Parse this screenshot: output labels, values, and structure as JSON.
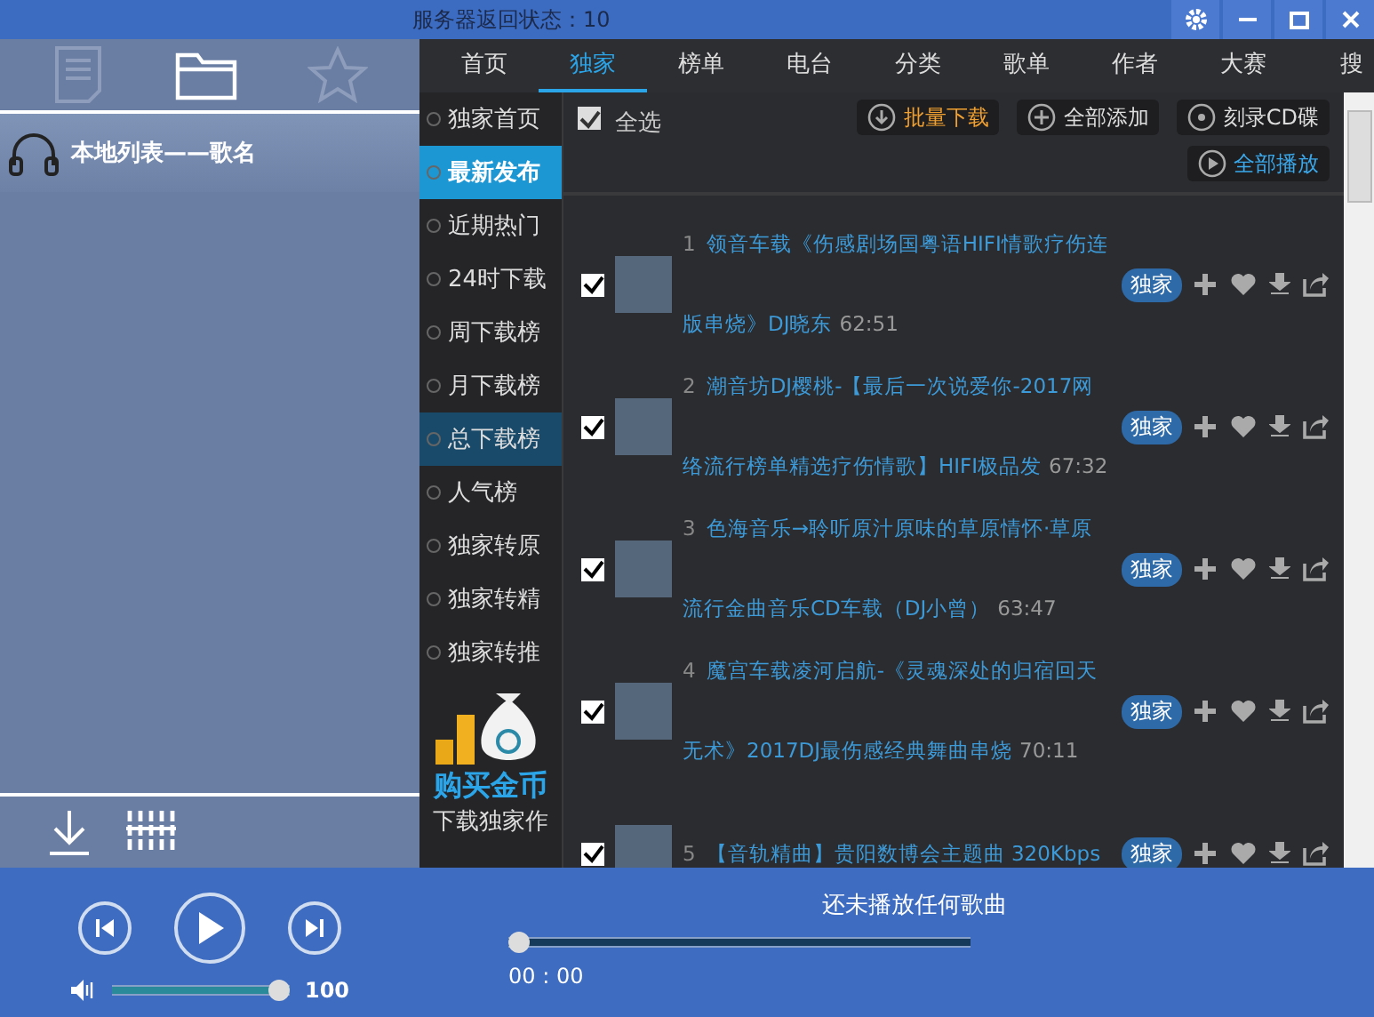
{
  "title_bar": {
    "status": "服务器返回状态：10"
  },
  "left_tabs": [
    {
      "selected": false
    },
    {
      "selected": true
    },
    {
      "selected": false
    }
  ],
  "playlist_header": {
    "label": "本地列表——歌名"
  },
  "nav_tabs": [
    {
      "label": "首页",
      "selected": false
    },
    {
      "label": "独家",
      "selected": true
    },
    {
      "label": "榜单",
      "selected": false
    },
    {
      "label": "电台",
      "selected": false
    },
    {
      "label": "分类",
      "selected": false
    },
    {
      "label": "歌单",
      "selected": false
    },
    {
      "label": "作者",
      "selected": false
    },
    {
      "label": "大赛",
      "selected": false
    },
    {
      "label": "搜",
      "selected": false
    }
  ],
  "categories": [
    {
      "label": "独家首页",
      "selected": false,
      "highlighted": false
    },
    {
      "label": "最新发布",
      "selected": true,
      "highlighted": false
    },
    {
      "label": "近期热门",
      "selected": false,
      "highlighted": false
    },
    {
      "label": "24时下载",
      "selected": false,
      "highlighted": false
    },
    {
      "label": "周下载榜",
      "selected": false,
      "highlighted": false
    },
    {
      "label": "月下载榜",
      "selected": false,
      "highlighted": false
    },
    {
      "label": "总下载榜",
      "selected": false,
      "highlighted": true
    },
    {
      "label": "人气榜",
      "selected": false,
      "highlighted": false
    },
    {
      "label": "独家转原",
      "selected": false,
      "highlighted": false
    },
    {
      "label": "独家转精",
      "selected": false,
      "highlighted": false
    },
    {
      "label": "独家转推",
      "selected": false,
      "highlighted": false
    }
  ],
  "promo": {
    "title": "购买金币",
    "subtitle": "下载独家作"
  },
  "toolbar": {
    "select_all": {
      "label": "全选",
      "checked": true
    },
    "buttons": [
      {
        "label": "批量下载",
        "kind": "accent"
      },
      {
        "label": "全部添加",
        "kind": "normal"
      },
      {
        "label": "刻录CD碟",
        "kind": "normal"
      },
      {
        "label": "全部播放",
        "kind": "link"
      }
    ]
  },
  "songs": [
    {
      "number": "1",
      "title": "领音车载《伤感剧场国粤语HIFI情歌疗伤连版串烧》DJ晓东",
      "duration": "62:51",
      "badge": "独家",
      "checked": true
    },
    {
      "number": "2",
      "title": "潮音坊DJ樱桃-【最后一次说爱你-2017网络流行榜单精选疗伤情歌】HIFI极品发",
      "duration": "67:32",
      "badge": "独家",
      "checked": true
    },
    {
      "number": "3",
      "title": "色海音乐→聆听原汁原味的草原情怀·草原流行金曲音乐CD车载（DJ小曾）",
      "duration": "63:47",
      "badge": "独家",
      "checked": true
    },
    {
      "number": "4",
      "title": "魔宫车载凌河启航-《灵魂深处的归宿回天无术》2017DJ最伤感经典舞曲串烧",
      "duration": "70:11",
      "badge": "独家",
      "checked": true
    },
    {
      "number": "5",
      "title": "【音轨精曲】贵阳数博会主题曲 320Kbps",
      "badge": "独家",
      "checked": true
    }
  ],
  "player": {
    "now_playing": "还未播放任何歌曲",
    "volume": {
      "level": 1,
      "reading": "100"
    },
    "progress": {
      "level": 0,
      "time": "00 : 00"
    }
  }
}
